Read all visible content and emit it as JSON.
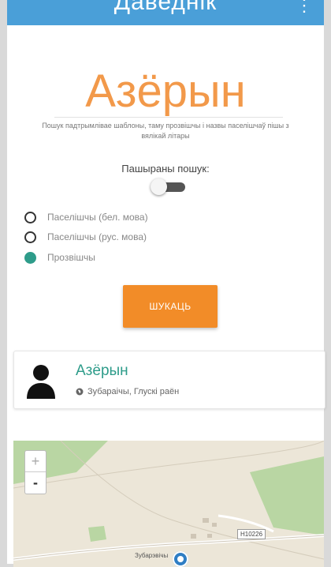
{
  "app": {
    "title": "Даведнік"
  },
  "search": {
    "word": "Азёрын",
    "hint": "Пошук падтрымлівае шаблоны, таму прозвішчы і назвы паселішчаў пішы з вялікай літары",
    "advanced_label": "Пашыраны пошук:",
    "advanced_enabled": false,
    "options": [
      {
        "label": "Паселішчы (бел. мова)",
        "selected": false
      },
      {
        "label": "Паселішчы (рус. мова)",
        "selected": false
      },
      {
        "label": "Прозвішчы",
        "selected": true
      }
    ],
    "button_label": "ШУКАЦЬ"
  },
  "result": {
    "title": "Азёрын",
    "location": "Зубараічы, Глускі раён"
  },
  "map": {
    "zoom_in": "+",
    "zoom_out": "-",
    "road_label": "Н10226",
    "place_label": "Зубарэвічы"
  },
  "colors": {
    "accent": "#f28c28",
    "teal": "#2e9c8a",
    "appbar": "#4a9fd8"
  },
  "icons": {
    "person": "person-icon",
    "location": "globe-icon",
    "menu": "menu-icon",
    "pin": "map-pin-icon"
  }
}
